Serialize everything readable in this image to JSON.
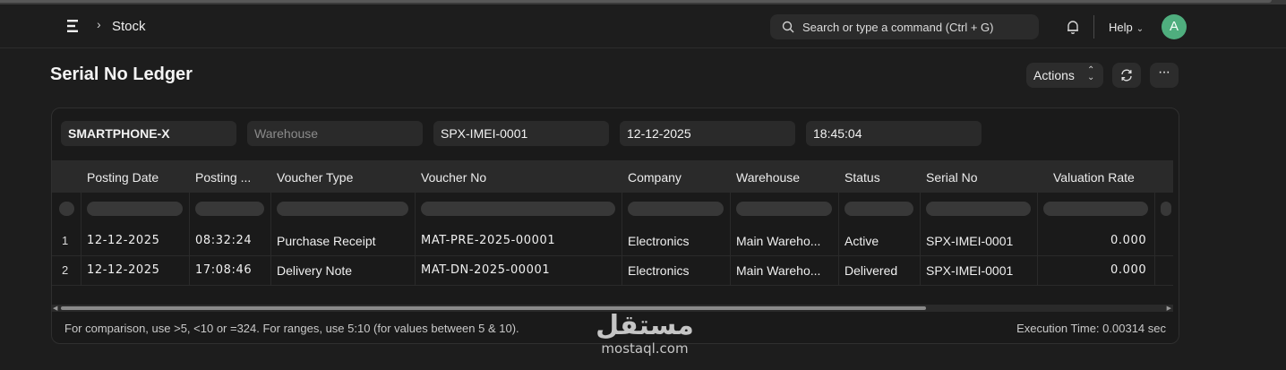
{
  "navbar": {
    "breadcrumb": "Stock",
    "search_placeholder": "Search or type a command (Ctrl + G)",
    "help_label": "Help",
    "avatar_initial": "A"
  },
  "page": {
    "title": "Serial No Ledger",
    "actions_label": "Actions"
  },
  "filters": {
    "item": "SMARTPHONE-X",
    "warehouse_placeholder": "Warehouse",
    "serial_no": "SPX-IMEI-0001",
    "posting_date": "12-12-2025",
    "posting_time": "18:45:04"
  },
  "table": {
    "columns": [
      "Posting Date",
      "Posting ...",
      "Voucher Type",
      "Voucher No",
      "Company",
      "Warehouse",
      "Status",
      "Serial No",
      "Valuation Rate"
    ],
    "rows": [
      {
        "n": "1",
        "posting_date": "12-12-2025",
        "posting_time": "08:32:24",
        "voucher_type": "Purchase Receipt",
        "voucher_no": "MAT-PRE-2025-00001",
        "company": "Electronics",
        "warehouse": "Main Wareho...",
        "status": "Active",
        "serial_no": "SPX-IMEI-0001",
        "valuation_rate": "0.000"
      },
      {
        "n": "2",
        "posting_date": "12-12-2025",
        "posting_time": "17:08:46",
        "voucher_type": "Delivery Note",
        "voucher_no": "MAT-DN-2025-00001",
        "company": "Electronics",
        "warehouse": "Main Wareho...",
        "status": "Delivered",
        "serial_no": "SPX-IMEI-0001",
        "valuation_rate": "0.000"
      }
    ]
  },
  "footer": {
    "help_text": "For comparison, use >5, <10 or =324. For ranges, use 5:10 (for values between 5 & 10).",
    "execution_time": "Execution Time: 0.00314 sec"
  },
  "watermark": {
    "arabic": "مستقل",
    "latin": "mostaql.com"
  },
  "colors": {
    "background": "#1d1d1d",
    "card": "#1a1a1a",
    "avatar": "#4fae7e"
  }
}
